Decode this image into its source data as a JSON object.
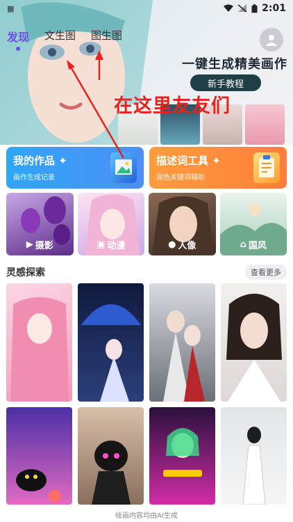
{
  "status_bar": {
    "left_icon": "qr-icon",
    "time": "2:01"
  },
  "top_tabs": [
    {
      "label": "发现",
      "active": true
    },
    {
      "label": "文生图",
      "active": false
    },
    {
      "label": "图生图",
      "active": false
    }
  ],
  "hero": {
    "slogan": "一键生成精美画作",
    "newbie_button": "新手教程",
    "annotation_text": "在这里友友们"
  },
  "feature_cards": [
    {
      "title": "我的作品",
      "subtitle": "画作生成记录",
      "icon": "gallery-icon",
      "color": "#3a9cf6"
    },
    {
      "title": "描述词工具",
      "subtitle": "润色关键词辅助",
      "icon": "notepad-icon",
      "color": "#ff8c3a"
    }
  ],
  "categories": [
    {
      "label": "摄影",
      "icon": "camera-icon"
    },
    {
      "label": "动漫",
      "icon": "image-icon"
    },
    {
      "label": "人像",
      "icon": "person-icon"
    },
    {
      "label": "国风",
      "icon": "pavilion-icon"
    }
  ],
  "inspiration": {
    "title": "灵感探索",
    "more_label": "查看更多"
  },
  "footer_text": "绘画内容均由AI生成"
}
